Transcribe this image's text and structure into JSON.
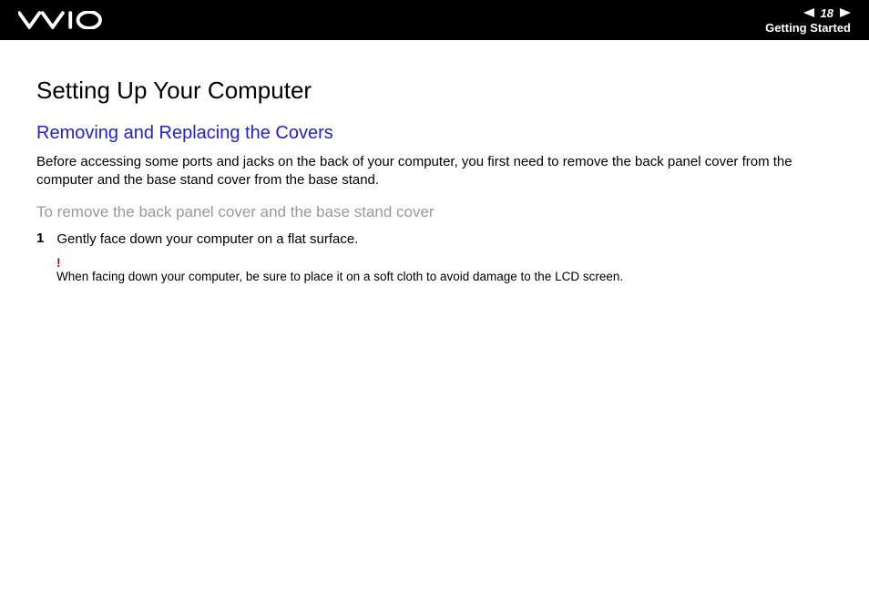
{
  "header": {
    "logo_name": "vaio-logo",
    "page_number": "18",
    "section_label": "Getting Started"
  },
  "content": {
    "main_heading": "Setting Up Your Computer",
    "sub_heading": "Removing and Replacing the Covers",
    "intro_text": "Before accessing some ports and jacks on the back of your computer, you first need to remove the back panel cover from the computer and the base stand cover from the base stand.",
    "procedure_heading": "To remove the back panel cover and the base stand cover",
    "steps": [
      {
        "number": "1",
        "text": "Gently face down your computer on a flat surface."
      }
    ],
    "caution": {
      "mark": "!",
      "text": "When facing down your computer, be sure to place it on a soft cloth to avoid damage to the LCD screen."
    }
  }
}
